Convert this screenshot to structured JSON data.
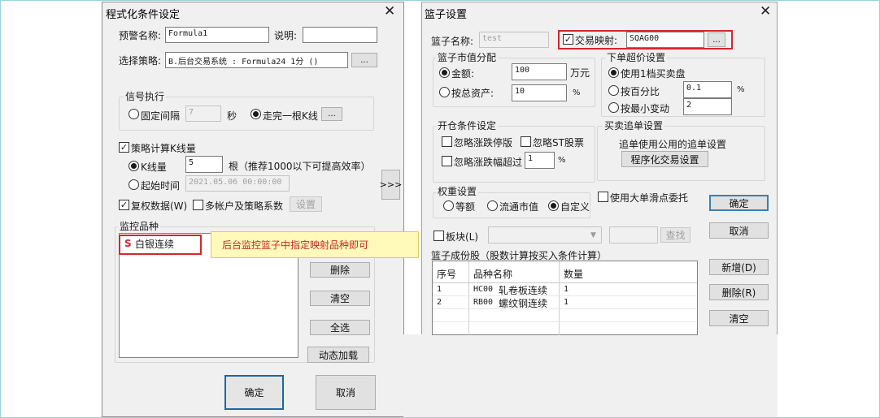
{
  "left_dialog": {
    "title": "程式化条件设定",
    "alert_name_label": "预警名称:",
    "alert_name_value": "Formula1",
    "desc_label": "说明:",
    "desc_value": "",
    "strategy_label": "选择策略:",
    "strategy_value": "B.后台交易系统 : Formula24 1分 ()",
    "ellipsis": "...",
    "signal_group": "信号执行",
    "fixed_interval_label": "固定间隔",
    "fixed_interval_value": "7",
    "seconds_unit": "秒",
    "after_bar_label": "走完一根K线",
    "calc_bars_label": "策略计算K线量",
    "bar_count_label": "K线量",
    "bar_count_value": "5",
    "bar_count_hint": "根（推荐1000以下可提高效率）",
    "start_time_label": "起始时间",
    "start_time_value": "2021.05.06 00:00:00",
    "adjusted_label": "复权数据(W)",
    "multi_account_label": "多帐户及策略系数",
    "settings_button": "设置",
    "expand_button": ">>>",
    "monitor_group": "监控品种",
    "monitor_item_prefix": "S",
    "monitor_item_name": "白银连续",
    "callout_text": "后台监控篮子中指定映射品种即可",
    "delete_button": "删除",
    "clear_button": "清空",
    "select_all_button": "全选",
    "dynamic_load_button": "动态加载",
    "ok_button": "确定",
    "cancel_button": "取消"
  },
  "right_dialog": {
    "title": "篮子设置",
    "basket_name_label": "篮子名称:",
    "basket_name_value": "test",
    "trade_map_label": "交易映射:",
    "trade_map_value": "SQAG00",
    "ellipsis": "...",
    "value_alloc_group": "篮子市值分配",
    "amount_label": "金额:",
    "amount_value": "100",
    "amount_unit": "万元",
    "total_assets_label": "按总资产:",
    "total_assets_value": "10",
    "percent_unit": "%",
    "over_price_group": "下单超价设置",
    "use_level1_label": "使用1档买卖盘",
    "by_percent_label": "按百分比",
    "by_percent_value": "0.1",
    "by_min_tick_label": "按最小变动",
    "by_min_tick_value": "2",
    "open_cond_group": "开仓条件设定",
    "ignore_limit_label": "忽略涨跌停版",
    "ignore_st_label": "忽略ST股票",
    "ignore_range_label": "忽略涨跌幅超过",
    "ignore_range_value": "1",
    "chase_group": "买卖追单设置",
    "chase_text": "追单使用公用的追单设置",
    "program_trade_button": "程序化交易设置",
    "weight_group": "权重设置",
    "equal_weight_label": "等额",
    "float_cap_label": "流通市值",
    "custom_label": "自定义",
    "big_order_label": "使用大单滑点委托",
    "sector_label": "板块(L)",
    "search_button": "查找",
    "components_label": "篮子成份股（股数计算按买入条件计算）",
    "table_headers": [
      "序号",
      "品种名称",
      "数量"
    ],
    "table_rows": [
      {
        "idx": "1",
        "code": "HC00",
        "name": "轧卷板连续",
        "qty": "1"
      },
      {
        "idx": "2",
        "code": "RB00",
        "name": "螺纹钢连续",
        "qty": "1"
      }
    ],
    "ok_button": "确定",
    "cancel_button": "取消",
    "add_button": "新增(D)",
    "delete_button": "删除(R)",
    "clear_button": "清空"
  },
  "colors": {
    "highlight_red": "#d6262c",
    "callout_bg": "#fffab9",
    "dialog_bg": "#f0f0f0"
  }
}
